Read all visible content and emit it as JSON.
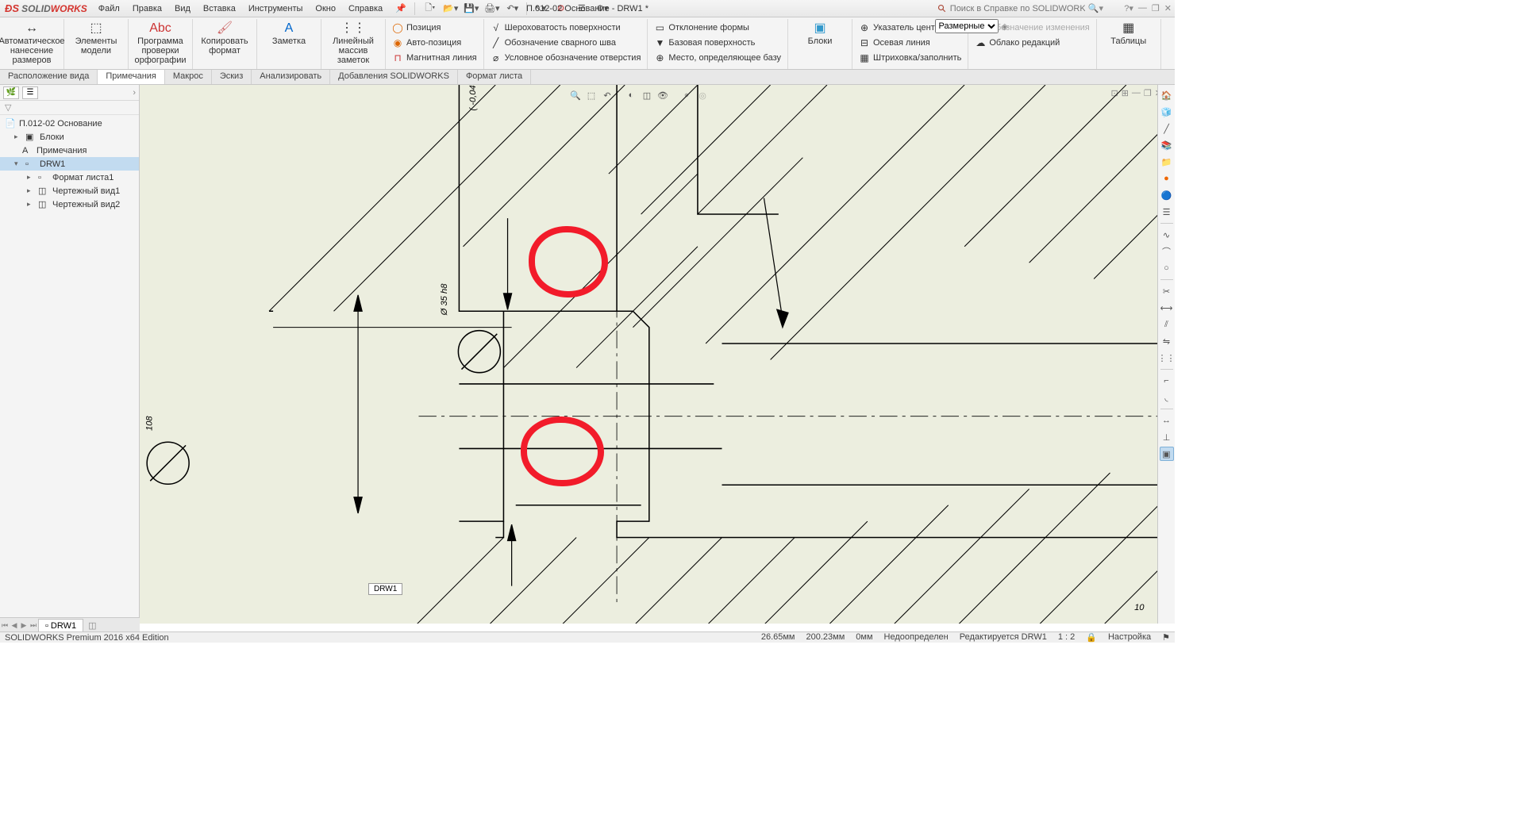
{
  "logo": {
    "ds": "ƉS",
    "sw": "SOLID",
    "works": "WORKS"
  },
  "menu": {
    "file": "Файл",
    "edit": "Правка",
    "view": "Вид",
    "insert": "Вставка",
    "tools": "Инструменты",
    "window": "Окно",
    "help": "Справка"
  },
  "doc_title": "П.012-02 Основание - DRW1 *",
  "search_placeholder": "Поиск в Справке по SOLIDWORKS",
  "ribbon": {
    "auto_dim": "Автоматическое\nнанесение размеров",
    "model_items": "Элементы\nмодели",
    "spell": "Программа\nпроверки\nорфографии",
    "copy_fmt": "Копировать\nформат",
    "note": "Заметка",
    "linear_note": "Линейный\nмассив заметок",
    "position": "Позиция",
    "auto_position": "Авто-позиция",
    "magnetic": "Магнитная линия",
    "surface_finish": "Шероховатость поверхности",
    "weld": "Обозначение сварного шва",
    "hole": "Условное обозначение отверстия",
    "form_tol": "Отклонение формы",
    "datum": "Базовая поверхность",
    "datum_target": "Место, определяющее базу",
    "blocks": "Блоки",
    "center_mark": "Указатель центра",
    "centerline": "Осевая линия",
    "hatch": "Штриховка/заполнить",
    "rev_symbol": "Обозначение изменения",
    "rev_cloud": "Облако редакций",
    "tables": "Таблицы"
  },
  "tabs": {
    "layout": "Расположение вида",
    "annot": "Примечания",
    "macro": "Макрос",
    "sketch": "Эскиз",
    "analyze": "Анализировать",
    "addins": "Добавления SOLIDWORKS",
    "format": "Формат листа"
  },
  "dim_dropdown": "Размерные",
  "tree": {
    "root": "П.012-02 Основание",
    "blocks": "Блоки",
    "annotations": "Примечания",
    "drw": "DRW1",
    "sheet_fmt": "Формат листа1",
    "view1": "Чертежный вид1",
    "view2": "Чертежный вид2"
  },
  "drawing": {
    "dim1": "Ø 35 h8",
    "tol1": "-0,04",
    "dim2": "108",
    "dim3": "10",
    "corner": "10"
  },
  "sheet_tab": "DRW1",
  "sheet_tooltip": "DRW1",
  "status": {
    "edition": "SOLIDWORKS Premium 2016 x64 Edition",
    "x": "26.65мм",
    "y": "200.23мм",
    "z": "0мм",
    "under": "Недоопределен",
    "editing": "Редактируется DRW1",
    "scale": "1 : 2",
    "custom": "Настройка"
  }
}
